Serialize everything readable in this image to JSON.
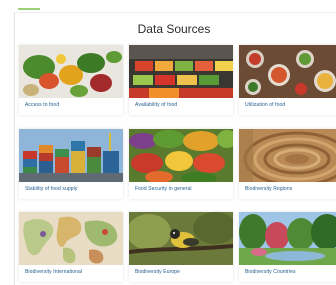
{
  "header": {
    "title": "Data Sources"
  },
  "cards": [
    {
      "label": "Access to food",
      "image": "vegetables-and-fruit-photo"
    },
    {
      "label": "Availability of food",
      "image": "market-stall-photo"
    },
    {
      "label": "Utilization of food",
      "image": "bowls-of-food-photo"
    },
    {
      "label": "Stability of food supply",
      "image": "shipping-containers-photo"
    },
    {
      "label": "Food Security in general",
      "image": "fresh-produce-photo"
    },
    {
      "label": "Biodiversity Regions",
      "image": "rice-terraces-aerial-photo"
    },
    {
      "label": "Biodiversity International",
      "image": "world-map-photo"
    },
    {
      "label": "Biodiversity Europe",
      "image": "bird-on-branch-photo"
    },
    {
      "label": "Biodiversity Countries",
      "image": "park-landscape-photo"
    }
  ]
}
